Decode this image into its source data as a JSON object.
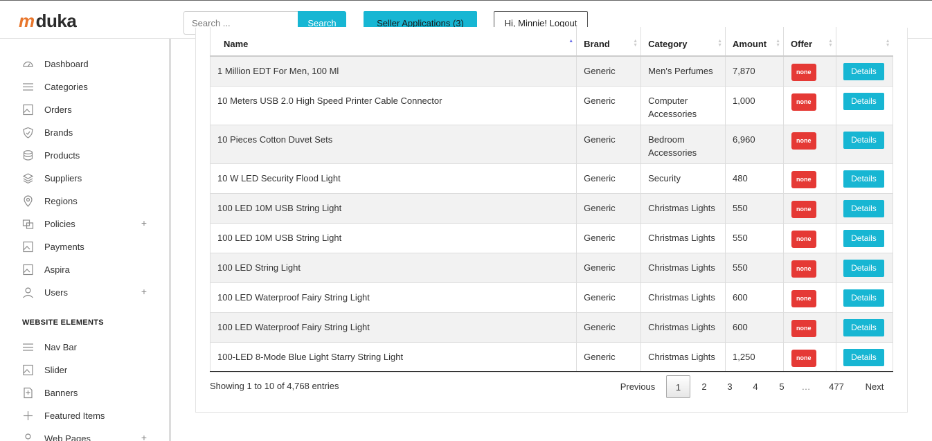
{
  "header": {
    "logo_mark": "m",
    "logo_text": "duka",
    "search_placeholder": "Search ...",
    "search_button": "Search",
    "seller_button": "Seller Applications  (3)",
    "user_button": "Hi, Minnie! Logout"
  },
  "sidebar": {
    "items": [
      {
        "label": "Dashboard",
        "icon": "gauge-icon"
      },
      {
        "label": "Categories",
        "icon": "list-icon"
      },
      {
        "label": "Orders",
        "icon": "image-icon"
      },
      {
        "label": "Brands",
        "icon": "shield-icon"
      },
      {
        "label": "Products",
        "icon": "database-icon"
      },
      {
        "label": "Suppliers",
        "icon": "layers-icon"
      },
      {
        "label": "Regions",
        "icon": "map-pin-icon"
      },
      {
        "label": "Policies",
        "icon": "thumbs-icon"
      },
      {
        "label": "Payments",
        "icon": "image-icon"
      },
      {
        "label": "Aspira",
        "icon": "image-icon"
      },
      {
        "label": "Users",
        "icon": "user-icon"
      }
    ],
    "section_title": "WEBSITE ELEMENTS",
    "website_items": [
      {
        "label": "Nav Bar",
        "icon": "list-icon"
      },
      {
        "label": "Slider",
        "icon": "image-icon"
      },
      {
        "label": "Banners",
        "icon": "file-icon"
      },
      {
        "label": "Featured Items",
        "icon": "plus-icon"
      },
      {
        "label": "Web Pages",
        "icon": "user-icon"
      }
    ],
    "expand_symbol": "+"
  },
  "table": {
    "columns": [
      "Name",
      "Brand",
      "Category",
      "Amount",
      "Offer",
      ""
    ],
    "rows": [
      {
        "name": "1 Million EDT For Men, 100 Ml",
        "brand": "Generic",
        "category": "Men's Perfumes",
        "amount": "7,870",
        "offer": "none",
        "action": "Details"
      },
      {
        "name": "10 Meters USB 2.0 High Speed Printer Cable Connector",
        "brand": "Generic",
        "category": "Computer Accessories",
        "amount": "1,000",
        "offer": "none",
        "action": "Details"
      },
      {
        "name": "10 Pieces Cotton Duvet Sets",
        "brand": "Generic",
        "category": "Bedroom Accessories",
        "amount": "6,960",
        "offer": "none",
        "action": "Details"
      },
      {
        "name": "10 W LED Security Flood Light",
        "brand": "Generic",
        "category": "Security",
        "amount": "480",
        "offer": "none",
        "action": "Details"
      },
      {
        "name": "100 LED 10M USB String Light",
        "brand": "Generic",
        "category": "Christmas Lights",
        "amount": "550",
        "offer": "none",
        "action": "Details"
      },
      {
        "name": "100 LED 10M USB String Light",
        "brand": "Generic",
        "category": "Christmas Lights",
        "amount": "550",
        "offer": "none",
        "action": "Details"
      },
      {
        "name": "100 LED String Light",
        "brand": "Generic",
        "category": "Christmas Lights",
        "amount": "550",
        "offer": "none",
        "action": "Details"
      },
      {
        "name": "100 LED Waterproof Fairy String Light",
        "brand": "Generic",
        "category": "Christmas Lights",
        "amount": "600",
        "offer": "none",
        "action": "Details"
      },
      {
        "name": "100 LED Waterproof Fairy String Light",
        "brand": "Generic",
        "category": "Christmas Lights",
        "amount": "600",
        "offer": "none",
        "action": "Details"
      },
      {
        "name": "100-LED 8-Mode Blue Light Starry String Light",
        "brand": "Generic",
        "category": "Christmas Lights",
        "amount": "1,250",
        "offer": "none",
        "action": "Details"
      }
    ]
  },
  "footer": {
    "info": "Showing 1 to 10 of 4,768 entries",
    "pagination": [
      "Previous",
      "1",
      "2",
      "3",
      "4",
      "5",
      "…",
      "477",
      "Next"
    ],
    "current_page": "1"
  },
  "colors": {
    "accent": "#17b6d3",
    "badge": "#e53935",
    "logo_mark": "#e8762c"
  }
}
